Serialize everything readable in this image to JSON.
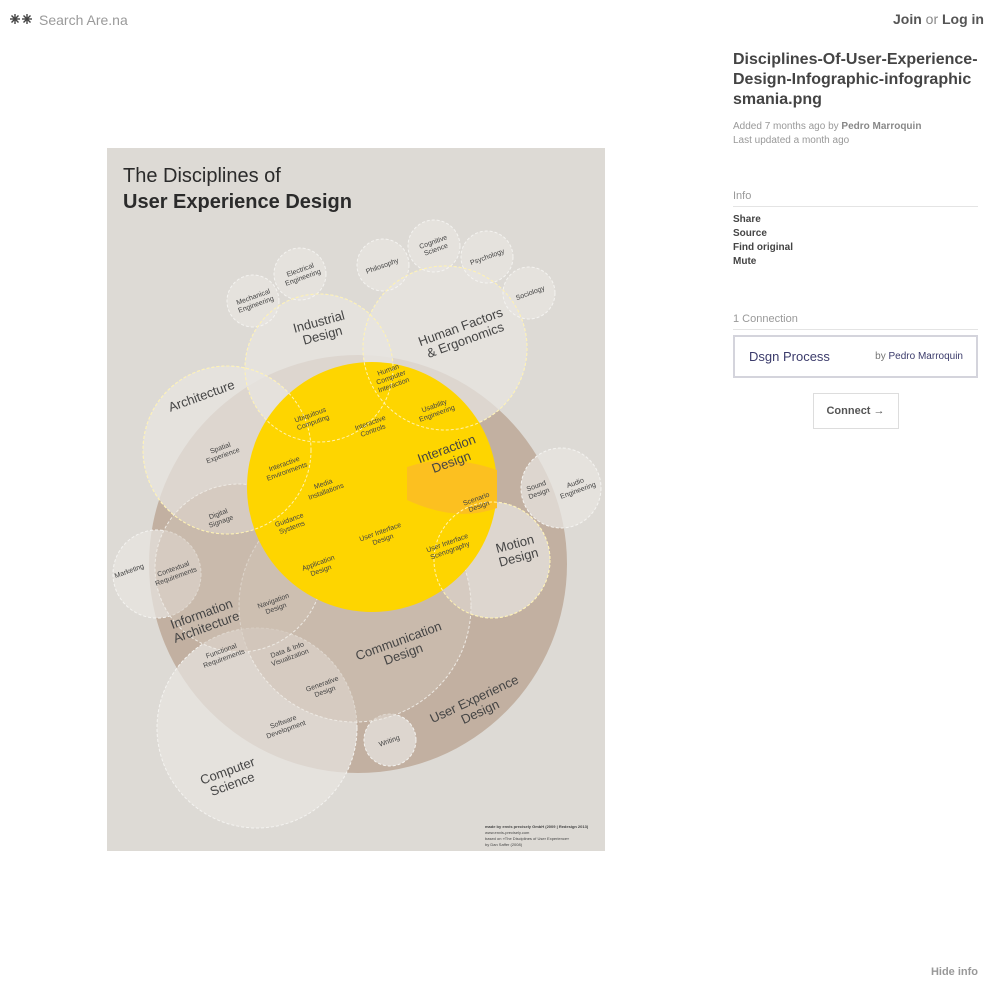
{
  "header": {
    "search_placeholder": "Search Are.na",
    "join": "Join",
    "or": "or",
    "login": "Log in"
  },
  "sidebar": {
    "title": "Disciplines-Of-User-Experience-Design-Infographic-infographicsmania.png",
    "added_prefix": "Added 7 months ago by",
    "added_by": "Pedro Marroquin",
    "updated": "Last updated a month ago",
    "info_heading": "Info",
    "info_links": [
      "Share",
      "Source",
      "Find original",
      "Mute"
    ],
    "connections_heading": "1 Connection",
    "connection": {
      "title": "Dsgn Process",
      "by_prefix": "by",
      "by": "Pedro Marroquin"
    },
    "connect_label": "Connect →",
    "hide_info": "Hide info"
  },
  "infographic": {
    "title_line1": "The Disciplines of",
    "title_line2": "User Experience Design",
    "labels": {
      "mech": [
        "Mechanical",
        "Engineering"
      ],
      "elec": [
        "Electrical",
        "Engineering"
      ],
      "phil": [
        "Philosophy"
      ],
      "cog": [
        "Cognitive",
        "Science"
      ],
      "psych": [
        "Psychology"
      ],
      "soc": [
        "Sociology"
      ],
      "industrial": [
        "Industrial",
        "Design"
      ],
      "hf": [
        "Human Factors",
        "& Ergonomics"
      ],
      "arch": [
        "Architecture"
      ],
      "hci": [
        "Human",
        "Computer",
        "Interaction"
      ],
      "usab": [
        "Usability",
        "Engineering"
      ],
      "ubiq": [
        "Ubiquitous",
        "Computing"
      ],
      "ictrl": [
        "Interactive",
        "Controls"
      ],
      "ixd": [
        "Interaction",
        "Design"
      ],
      "spatial": [
        "Spatial",
        "Experience"
      ],
      "ienv": [
        "Interactive",
        "Environments"
      ],
      "media": [
        "Media",
        "Installations"
      ],
      "scen": [
        "Scenario",
        "Design"
      ],
      "sound": [
        "Sound",
        "Design"
      ],
      "audio": [
        "Audio",
        "Engineering"
      ],
      "dsig": [
        "Digital",
        "Signage"
      ],
      "guid": [
        "Guidance",
        "Systems"
      ],
      "uid": [
        "User Interface",
        "Design"
      ],
      "uis": [
        "User Interface",
        "Scenography"
      ],
      "motion": [
        "Motion",
        "Design"
      ],
      "mkt": [
        "Marketing"
      ],
      "ctx": [
        "Contextual",
        "Requirements"
      ],
      "app": [
        "Application",
        "Design"
      ],
      "nav": [
        "Navigation",
        "Design"
      ],
      "ia": [
        "Information",
        "Architecture"
      ],
      "func": [
        "Functional",
        "Requirements"
      ],
      "dataviz": [
        "Data & Info",
        "Visualization"
      ],
      "comm": [
        "Communication",
        "Design"
      ],
      "gen": [
        "Generative",
        "Design"
      ],
      "ux": [
        "User Experience",
        "Design"
      ],
      "sw": [
        "Software",
        "Development"
      ],
      "writing": [
        "Writing"
      ],
      "cs": [
        "Computer",
        "Science"
      ]
    },
    "credits": [
      "made by envis precisely GmbH (2009 | Redesign 2013)",
      "www.envis-precisely.com",
      "based on »The Disciplines of User Experience«",
      "by Dan Saffer (2008)"
    ]
  }
}
